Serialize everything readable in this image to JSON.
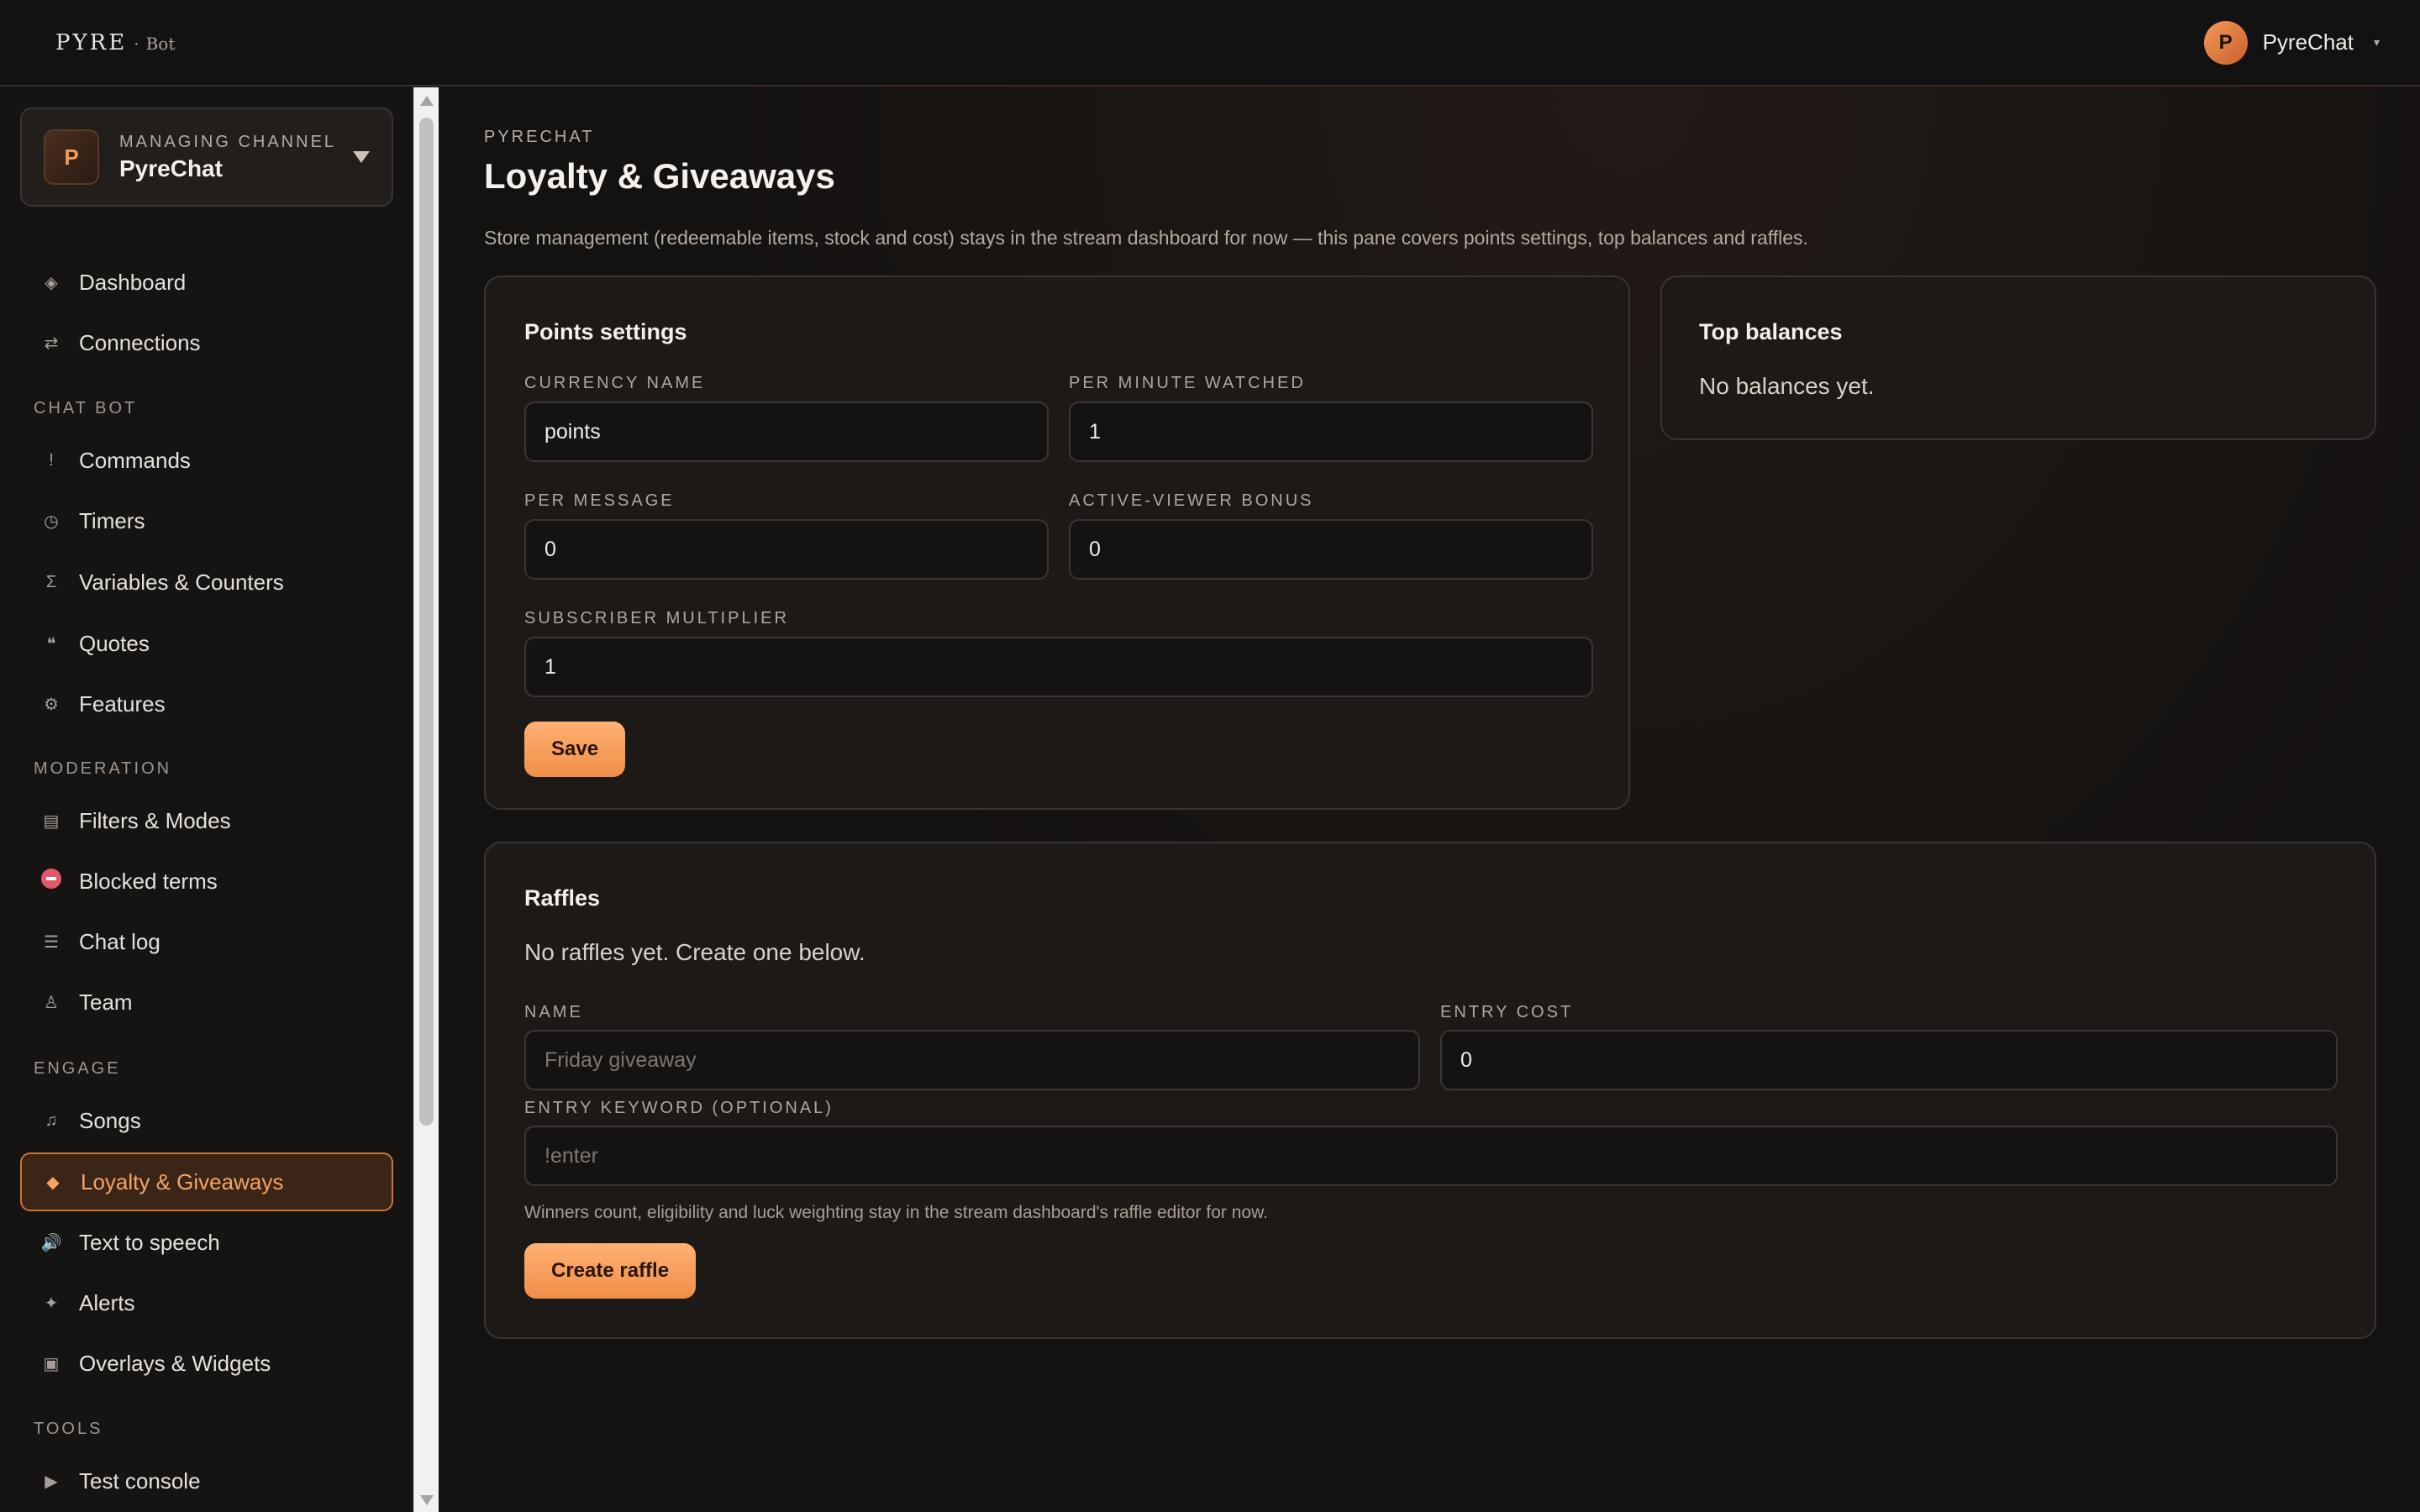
{
  "app": {
    "logo_word": "PYRE",
    "logo_sep": "·",
    "logo_sub": "Bot"
  },
  "user": {
    "initial": "P",
    "name": "PyreChat"
  },
  "channel": {
    "eyebrow": "MANAGING CHANNEL",
    "initial": "P",
    "name": "PyreChat"
  },
  "nav": {
    "dashboard": "Dashboard",
    "connections": "Connections",
    "section_chatbot": "CHAT BOT",
    "commands": "Commands",
    "timers": "Timers",
    "variables": "Variables & Counters",
    "quotes": "Quotes",
    "features": "Features",
    "section_moderation": "MODERATION",
    "filters": "Filters & Modes",
    "blocked": "Blocked terms",
    "chatlog": "Chat log",
    "team": "Team",
    "section_engage": "ENGAGE",
    "songs": "Songs",
    "loyalty": "Loyalty & Giveaways",
    "tts": "Text to speech",
    "alerts": "Alerts",
    "overlays": "Overlays & Widgets",
    "section_tools": "TOOLS",
    "test_console": "Test console",
    "icons": {
      "dashboard": "◈",
      "connections": "⇄",
      "commands": "!",
      "timers": "◷",
      "variables": "Σ",
      "quotes": "❝",
      "features": "⚙",
      "filters": "▤",
      "chatlog": "☰",
      "team": "♙",
      "songs": "♫",
      "loyalty": "◆",
      "tts": "🔊",
      "alerts": "✦",
      "overlays": "▣",
      "test_console": "▶"
    }
  },
  "page": {
    "crumb": "PYRECHAT",
    "title": "Loyalty & Giveaways",
    "description": "Store management (redeemable items, stock and cost) stays in the stream dashboard for now — this pane covers points settings, top balances and raffles."
  },
  "points": {
    "title": "Points settings",
    "currency_label": "CURRENCY NAME",
    "currency_value": "points",
    "per_minute_label": "PER MINUTE WATCHED",
    "per_minute_value": "1",
    "per_message_label": "PER MESSAGE",
    "per_message_value": "0",
    "bonus_label": "ACTIVE-VIEWER BONUS",
    "bonus_value": "0",
    "multiplier_label": "SUBSCRIBER MULTIPLIER",
    "multiplier_value": "1",
    "save_label": "Save"
  },
  "balances": {
    "title": "Top balances",
    "empty": "No balances yet."
  },
  "raffles": {
    "title": "Raffles",
    "empty": "No raffles yet. Create one below.",
    "name_label": "NAME",
    "name_placeholder": "Friday giveaway",
    "cost_label": "ENTRY COST",
    "cost_value": "0",
    "keyword_label": "ENTRY KEYWORD (OPTIONAL)",
    "keyword_placeholder": "!enter",
    "note": "Winners count, eligibility and luck weighting stay in the stream dashboard's raffle editor for now.",
    "create_label": "Create raffle"
  },
  "colors": {
    "accent": "#f5a466",
    "button": "#f08e48",
    "background": "#141211"
  }
}
